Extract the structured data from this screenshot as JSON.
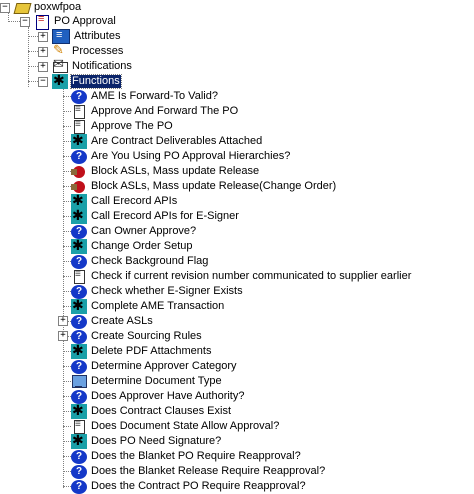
{
  "tree": {
    "root": {
      "label": "poxwfpoa",
      "icon": "package-icon"
    },
    "process": {
      "label": "PO Approval",
      "icon": "document-icon"
    },
    "categories": [
      {
        "label": "Attributes",
        "icon": "attributes-icon"
      },
      {
        "label": "Processes",
        "icon": "process-icon"
      },
      {
        "label": "Notifications",
        "icon": "notification-icon"
      },
      {
        "label": "Functions",
        "icon": "function-icon",
        "selected": true
      }
    ],
    "functions": [
      {
        "label": "AME Is Forward-To Valid?",
        "icon": "question-icon"
      },
      {
        "label": "Approve And Forward The PO",
        "icon": "document-icon"
      },
      {
        "label": "Approve The PO",
        "icon": "document-icon"
      },
      {
        "label": "Are Contract Deliverables Attached",
        "icon": "gear-icon"
      },
      {
        "label": "Are You Using PO Approval Hierarchies?",
        "icon": "question-icon"
      },
      {
        "label": "Block ASLs, Mass update Release",
        "icon": "stop-icon"
      },
      {
        "label": "Block ASLs, Mass update Release(Change Order)",
        "icon": "stop-icon"
      },
      {
        "label": "Call Erecord APIs",
        "icon": "gear-icon"
      },
      {
        "label": "Call Erecord APIs for E-Signer",
        "icon": "gear-icon"
      },
      {
        "label": "Can Owner Approve?",
        "icon": "question-icon"
      },
      {
        "label": "Change Order Setup",
        "icon": "gear-icon"
      },
      {
        "label": "Check Background Flag",
        "icon": "question-icon"
      },
      {
        "label": "Check if current revision number communicated to supplier earlier",
        "icon": "document-icon"
      },
      {
        "label": "Check whether E-Signer Exists",
        "icon": "question-icon"
      },
      {
        "label": "Complete AME Transaction",
        "icon": "gear-icon"
      },
      {
        "label": "Create ASLs",
        "icon": "question-icon",
        "expandable": true
      },
      {
        "label": "Create Sourcing Rules",
        "icon": "question-icon",
        "expandable": true
      },
      {
        "label": "Delete PDF Attachments",
        "icon": "gear-icon"
      },
      {
        "label": "Determine Approver Category",
        "icon": "question-icon"
      },
      {
        "label": "Determine Document Type",
        "icon": "computer-icon"
      },
      {
        "label": "Does Approver Have Authority?",
        "icon": "question-icon"
      },
      {
        "label": "Does Contract Clauses Exist",
        "icon": "gear-icon"
      },
      {
        "label": "Does Document State Allow Approval?",
        "icon": "document-icon"
      },
      {
        "label": "Does PO Need Signature?",
        "icon": "gear-icon"
      },
      {
        "label": "Does the Blanket PO Require Reapproval?",
        "icon": "question-icon"
      },
      {
        "label": "Does the Blanket Release Require Reapproval?",
        "icon": "question-icon"
      },
      {
        "label": "Does the Contract PO Require Reapproval?",
        "icon": "question-icon"
      }
    ],
    "expander": {
      "plus": "+",
      "minus": "−"
    },
    "question_glyph": "?"
  }
}
